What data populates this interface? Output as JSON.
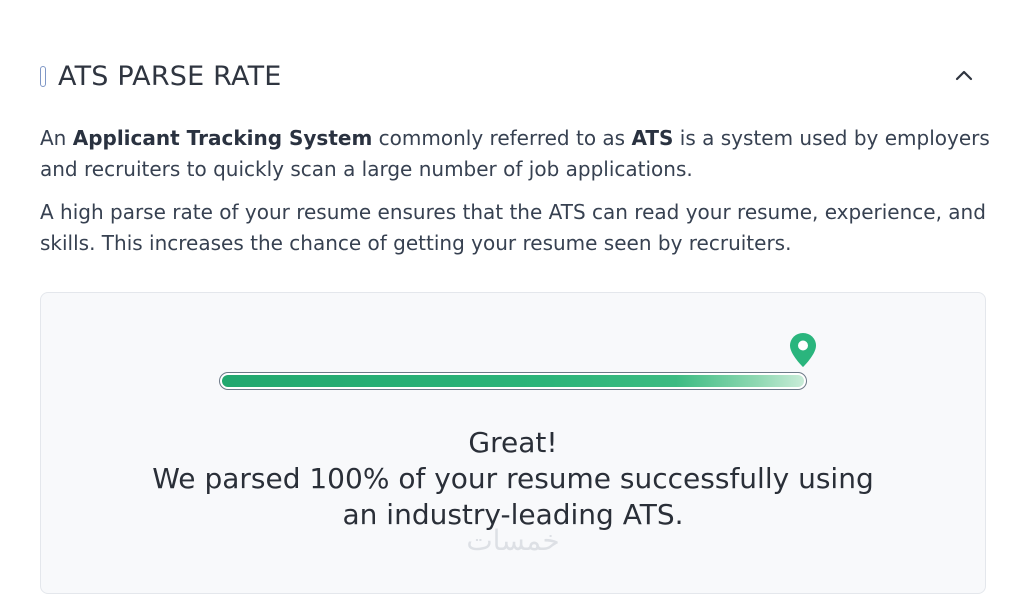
{
  "section": {
    "title": "ATS PARSE RATE",
    "collapse_icon": "chevron-up-icon"
  },
  "description": {
    "p1_prefix": "An ",
    "p1_bold1": "Applicant Tracking System",
    "p1_mid": " commonly referred to as ",
    "p1_bold2": "ATS",
    "p1_suffix": " is a system used by employers and recruiters to quickly scan a large number of job applications.",
    "p2": "A high parse rate of your resume ensures that the ATS can read your resume, experience, and skills. This increases the chance of getting your resume seen by recruiters."
  },
  "result": {
    "progress_percent": 100,
    "pin_icon": "map-pin-icon",
    "headline": "Great!",
    "message": "We parsed 100% of your resume successfully using",
    "message_line2": "an industry-leading ATS."
  },
  "watermark": {
    "text": "خمسات"
  },
  "colors": {
    "accent_green": "#2bb479",
    "pin_green": "#2ab57d",
    "header_mark": "#7f97c6"
  }
}
